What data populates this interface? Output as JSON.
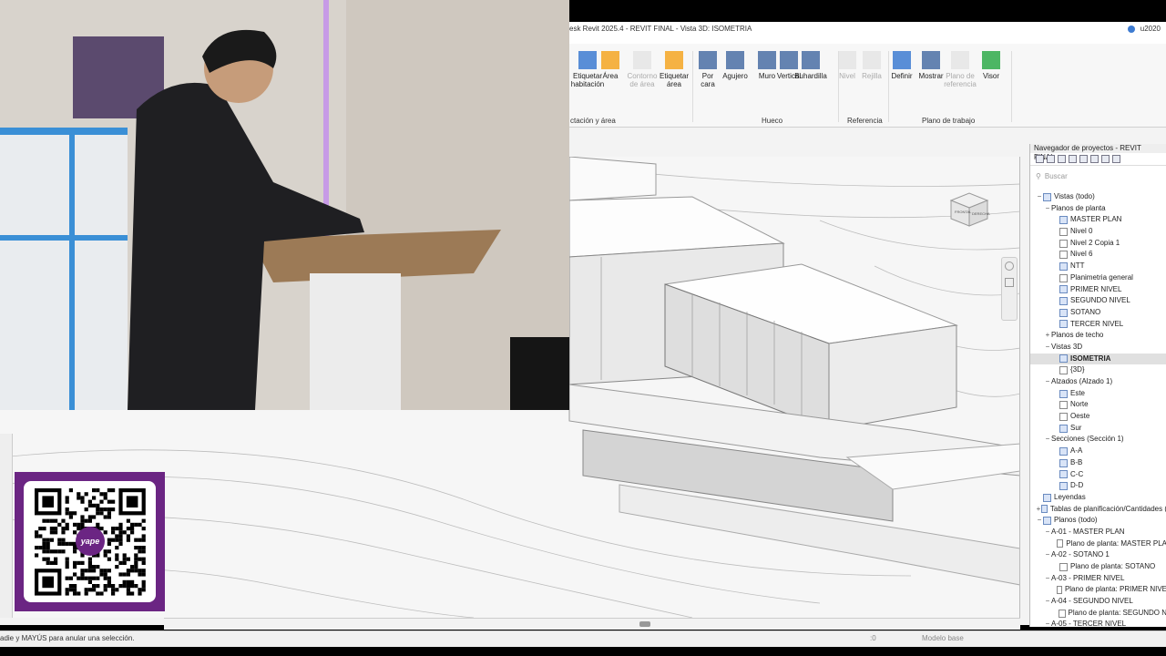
{
  "window": {
    "title": "esk Revit 2025.4 - REVIT FINAL - Vista 3D: ISOMETRIA",
    "user": "u2020"
  },
  "ribbon": {
    "buttons": [
      {
        "label": "Etiquetar\nhabitación",
        "icon": "tag-room-icon",
        "enabled": true
      },
      {
        "label": "Área",
        "icon": "area-icon",
        "enabled": true
      },
      {
        "label": "Contorno de área",
        "icon": "area-boundary-icon",
        "enabled": false
      },
      {
        "label": "Etiquetar\nárea",
        "icon": "tag-area-icon",
        "enabled": true
      },
      {
        "label": "Por\ncara",
        "icon": "by-face-icon",
        "enabled": true
      },
      {
        "label": "Agujero",
        "icon": "shaft-icon",
        "enabled": true
      },
      {
        "label": "Muro",
        "icon": "wall-opening-icon",
        "enabled": true
      },
      {
        "label": "Vertical",
        "icon": "vertical-opening-icon",
        "enabled": true
      },
      {
        "label": "Buhardilla",
        "icon": "dormer-icon",
        "enabled": true
      },
      {
        "label": "Nivel",
        "icon": "level-icon",
        "enabled": false
      },
      {
        "label": "Rejilla",
        "icon": "grid-icon",
        "enabled": false
      },
      {
        "label": "Definir",
        "icon": "set-workplane-icon",
        "enabled": true
      },
      {
        "label": "Mostrar",
        "icon": "show-workplane-icon",
        "enabled": true
      },
      {
        "label": "Plano de\nreferencia",
        "icon": "ref-plane-icon",
        "enabled": false
      },
      {
        "label": "Visor",
        "icon": "viewer-icon",
        "enabled": true
      }
    ],
    "groups": [
      "ctación y área",
      "Hueco",
      "Referencia",
      "Plano de trabajo"
    ]
  },
  "browser": {
    "title": "Navegador de proyectos - REVIT FINAL",
    "search_placeholder": "Buscar",
    "nodes": [
      {
        "label": "Vistas (todo)",
        "level": 0,
        "toggle": "−",
        "icon": "views-icon"
      },
      {
        "label": "Planos de planta",
        "level": 1,
        "toggle": "−"
      },
      {
        "label": "MASTER PLAN",
        "level": 2,
        "icon": "floor-plan-icon"
      },
      {
        "label": "Nivel 0",
        "level": 2,
        "icon": "floor-plan-icon",
        "plain": true
      },
      {
        "label": "Nivel 2 Copia 1",
        "level": 2,
        "icon": "floor-plan-icon",
        "plain": true
      },
      {
        "label": "Nivel 6",
        "level": 2,
        "icon": "floor-plan-icon",
        "plain": true
      },
      {
        "label": "NTT",
        "level": 2,
        "icon": "floor-plan-icon"
      },
      {
        "label": "Planimetria general",
        "level": 2,
        "icon": "floor-plan-icon",
        "plain": true
      },
      {
        "label": "PRIMER NIVEL",
        "level": 2,
        "icon": "floor-plan-icon"
      },
      {
        "label": "SEGUNDO NIVEL",
        "level": 2,
        "icon": "floor-plan-icon"
      },
      {
        "label": "SOTANO",
        "level": 2,
        "icon": "floor-plan-icon"
      },
      {
        "label": "TERCER NIVEL",
        "level": 2,
        "icon": "floor-plan-icon"
      },
      {
        "label": "Planos de techo",
        "level": 1,
        "toggle": "+"
      },
      {
        "label": "Vistas 3D",
        "level": 1,
        "toggle": "−"
      },
      {
        "label": "ISOMETRIA",
        "level": 2,
        "icon": "view-3d-icon",
        "selected": true
      },
      {
        "label": "{3D}",
        "level": 2,
        "icon": "view-3d-icon",
        "plain": true
      },
      {
        "label": "Alzados (Alzado 1)",
        "level": 1,
        "toggle": "−"
      },
      {
        "label": "Este",
        "level": 2,
        "icon": "elevation-icon"
      },
      {
        "label": "Norte",
        "level": 2,
        "icon": "elevation-icon",
        "plain": true
      },
      {
        "label": "Oeste",
        "level": 2,
        "icon": "elevation-icon",
        "plain": true
      },
      {
        "label": "Sur",
        "level": 2,
        "icon": "elevation-icon"
      },
      {
        "label": "Secciones (Sección 1)",
        "level": 1,
        "toggle": "−"
      },
      {
        "label": "A-A",
        "level": 2,
        "icon": "section-icon"
      },
      {
        "label": "B-B",
        "level": 2,
        "icon": "section-icon"
      },
      {
        "label": "C-C",
        "level": 2,
        "icon": "section-icon"
      },
      {
        "label": "D-D",
        "level": 2,
        "icon": "section-icon"
      },
      {
        "label": "Leyendas",
        "level": 0,
        "icon": "legend-icon"
      },
      {
        "label": "Tablas de planificación/Cantidades (",
        "level": 0,
        "toggle": "+",
        "icon": "schedule-icon"
      },
      {
        "label": "Planos (todo)",
        "level": 0,
        "toggle": "−",
        "icon": "sheets-icon"
      },
      {
        "label": "A-01 - MASTER PLAN",
        "level": 1,
        "toggle": "−"
      },
      {
        "label": "Plano de planta: MASTER PLA",
        "level": 2,
        "icon": "sheet-view-icon",
        "plain": true
      },
      {
        "label": "A-02 - SOTANO 1",
        "level": 1,
        "toggle": "−"
      },
      {
        "label": "Plano de planta: SOTANO",
        "level": 2,
        "icon": "sheet-view-icon",
        "plain": true
      },
      {
        "label": "A-03 - PRIMER NIVEL",
        "level": 1,
        "toggle": "−"
      },
      {
        "label": "Plano de planta: PRIMER NIVE",
        "level": 2,
        "icon": "sheet-view-icon",
        "plain": true
      },
      {
        "label": "A-04 - SEGUNDO NIVEL",
        "level": 1,
        "toggle": "−"
      },
      {
        "label": "Plano de planta: SEGUNDO N",
        "level": 2,
        "icon": "sheet-view-icon",
        "plain": true
      },
      {
        "label": "A-05 - TERCER NIVEL",
        "level": 1,
        "toggle": "−"
      }
    ]
  },
  "viewcube": {
    "face_front": "FRONTAL",
    "face_right": "DERECHA"
  },
  "status": {
    "hint": "adie y MAYÚS para anular una selección.",
    "counter": ":0",
    "model": "Modelo base"
  },
  "overlay": {
    "brand": "yape"
  },
  "colors": {
    "accent": "#6b2583",
    "ribbon_icon_orange": "#f5a623",
    "ribbon_icon_blue": "#3d7bd1"
  }
}
